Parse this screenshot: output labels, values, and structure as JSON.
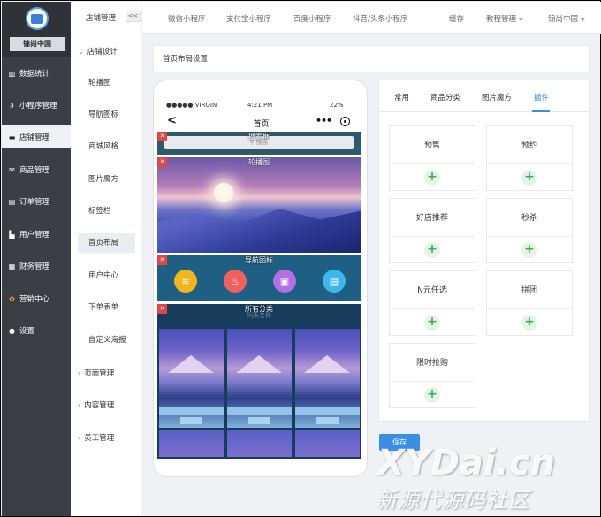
{
  "sidebar": {
    "brand": "锦尚中国",
    "items": [
      {
        "label": "数据统计",
        "icon": "chart-icon"
      },
      {
        "label": "小程序管理",
        "icon": "link-icon"
      },
      {
        "label": "店铺管理",
        "icon": "shop-icon"
      },
      {
        "label": "商品管理",
        "icon": "mail-icon"
      },
      {
        "label": "订单管理",
        "icon": "doc-icon"
      },
      {
        "label": "用户管理",
        "icon": "user-icon"
      },
      {
        "label": "财务管理",
        "icon": "finance-icon"
      },
      {
        "label": "营销中心",
        "icon": "flower-icon"
      },
      {
        "label": "设置",
        "icon": "gear-icon"
      }
    ],
    "active_index": 2
  },
  "subnav": {
    "title": "店铺管理",
    "collapse": "<<",
    "groups": {
      "design": "店铺设计",
      "pages": "页面管理",
      "content": "内容管理",
      "staff": "员工管理"
    },
    "items": [
      "轮播图",
      "导航图标",
      "商城风格",
      "图片魔方",
      "标签栏",
      "首页布局",
      "用户中心",
      "下单表单",
      "自定义海报"
    ],
    "active_index": 5
  },
  "topnav": {
    "items": [
      "微信小程序",
      "支付宝小程序",
      "百度小程序",
      "抖音/头条小程序",
      "缓存",
      "教程管理",
      "锦尚中国"
    ]
  },
  "breadcrumb": "首页布局设置",
  "phone": {
    "carrier": "●●●●● VIRGIN",
    "time": "4:21 PM",
    "battery": "22%",
    "title": "首页",
    "modules": {
      "search_label": "搜索框",
      "search_placeholder": "搜索",
      "banner_label": "轮播图",
      "nav_label": "导航图标",
      "cat_label": "所有分类",
      "cat_sub": "列表名称"
    }
  },
  "panel": {
    "tabs": [
      "常用",
      "商品分类",
      "图片魔方",
      "插件"
    ],
    "active_tab": 3,
    "cards": [
      "预售",
      "预约",
      "好店推荐",
      "秒杀",
      "N元任选",
      "拼团",
      "限时抢购"
    ],
    "plus": "+"
  },
  "save_label": "保存",
  "watermark": {
    "line1": "XYDai.cn",
    "line2": "新源代源码社区"
  },
  "colors": {
    "accent": "#3a8ee6",
    "sidebar": "#3b3e44",
    "plus": "#3cb04c",
    "danger": "#e04848"
  }
}
